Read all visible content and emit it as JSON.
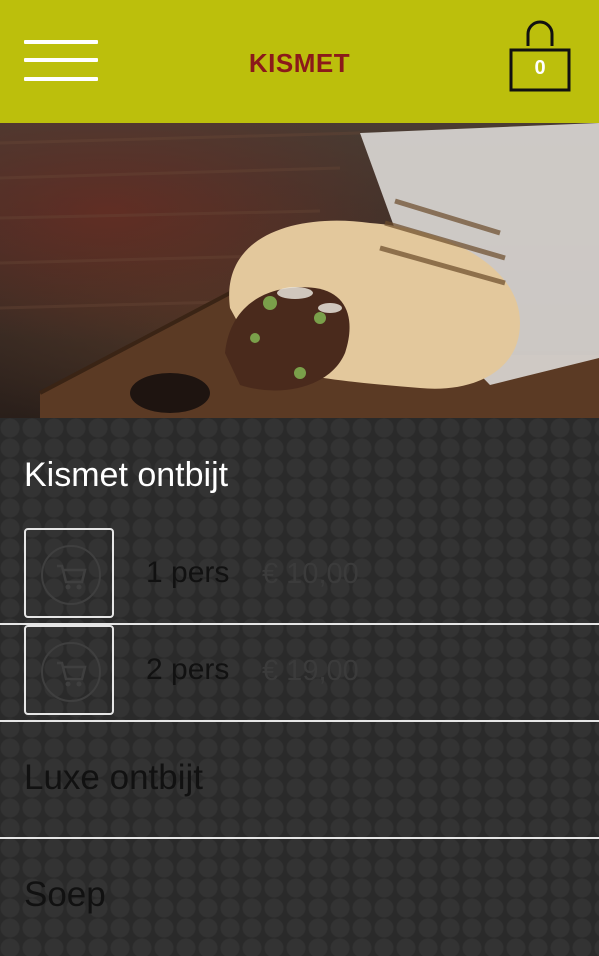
{
  "header": {
    "brand": "KISMET",
    "cart_count": "0",
    "menu_icon": "hamburger-menu-icon",
    "cart_icon": "shopping-bag-icon"
  },
  "colors": {
    "header_bg": "#bcbf0c",
    "brand": "#8b1a1a",
    "background": "#2b2b2b"
  },
  "hero": {
    "image": "shoarma wrap on wooden board"
  },
  "menu": {
    "category": {
      "title": "Kismet ontbijt",
      "options": [
        {
          "label": "1 pers",
          "price": "€ 10,00",
          "icon": "cart-icon"
        },
        {
          "label": "2 pers",
          "price": "€ 19,00",
          "icon": "cart-icon"
        }
      ]
    },
    "other_categories": [
      {
        "label": "Luxe ontbijt"
      },
      {
        "label": "Soep"
      }
    ]
  }
}
